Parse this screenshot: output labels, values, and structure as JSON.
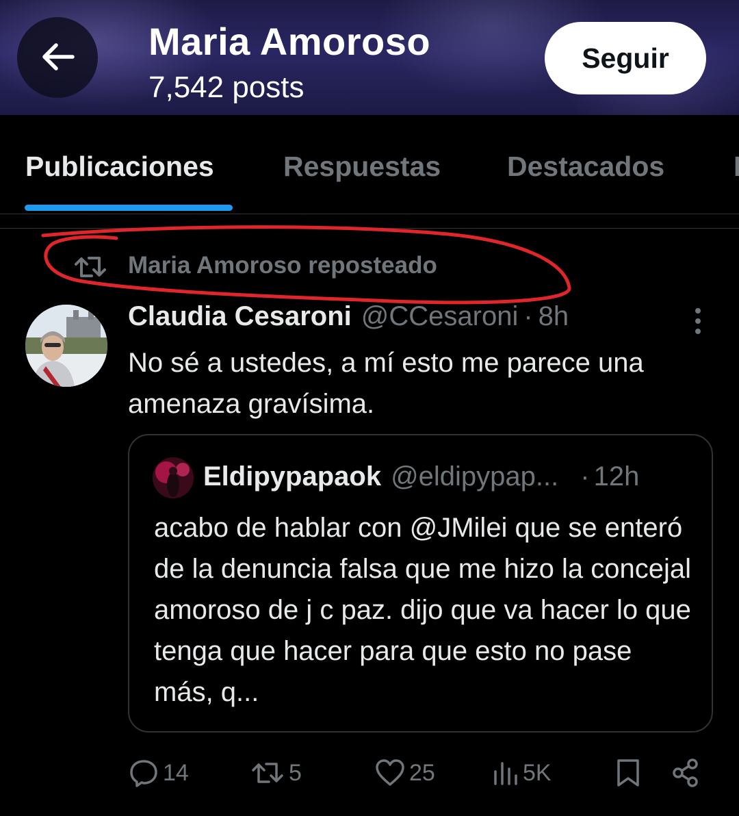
{
  "header": {
    "profile_name": "Maria Amoroso",
    "post_count": "7,542 posts",
    "follow_label": "Seguir"
  },
  "tabs": [
    {
      "label": "Publicaciones",
      "active": true
    },
    {
      "label": "Respuestas",
      "active": false
    },
    {
      "label": "Destacados",
      "active": false
    },
    {
      "label": "I",
      "active": false
    }
  ],
  "repost": {
    "label": "Maria Amoroso reposteado"
  },
  "post": {
    "author_name": "Claudia Cesaroni",
    "author_handle": "@CCesaroni",
    "separator": "·",
    "time": "8h",
    "text": "No sé a ustedes, a mí esto me parece una amenaza gravísima.",
    "quoted": {
      "author_name": "Eldipypapaok",
      "author_handle": "@eldipypap...",
      "separator": "·",
      "time": "12h",
      "text": "acabo de hablar con @JMilei que se enteró de la denuncia falsa que me hizo la concejal amoroso de j c paz. dijo que va hacer lo que tenga que hacer para que esto no pase más, q..."
    },
    "actions": {
      "replies": "14",
      "reposts": "5",
      "likes": "25",
      "views": "5K"
    }
  },
  "icons": {
    "back": "arrow-left-icon",
    "repost": "repost-icon",
    "more": "more-vertical-icon",
    "reply": "reply-icon",
    "like": "heart-icon",
    "views": "views-bar-icon",
    "bookmark": "bookmark-icon",
    "share": "share-icon"
  },
  "colors": {
    "background": "#000000",
    "text_primary": "#e7e9ea",
    "text_secondary": "#71767b",
    "accent": "#1d9bf0",
    "annotation": "#e0262b",
    "border": "#2f3336"
  }
}
